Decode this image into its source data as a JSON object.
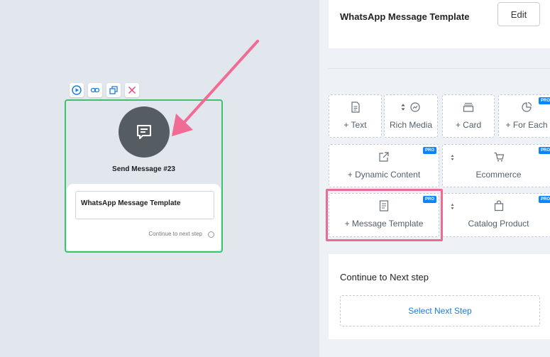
{
  "canvas": {
    "node": {
      "title": "Send Message #23",
      "template_label": "WhatsApp Message Template",
      "continue_label": "Continue to next step"
    }
  },
  "panel": {
    "title": "WhatsApp Message Template",
    "edit_label": "Edit",
    "tiles": [
      {
        "label": "+ Text",
        "icon": "text-icon",
        "pro": ""
      },
      {
        "label": "Rich Media",
        "icon": "rich-media-icon",
        "pro": ""
      },
      {
        "label": "+ Card",
        "icon": "card-icon",
        "pro": ""
      },
      {
        "label": "+ For Each",
        "icon": "for-each-icon",
        "pro": "PRO"
      },
      {
        "label": "+ Dynamic Content",
        "icon": "dynamic-content-icon",
        "pro": "PRO"
      },
      {
        "label": "Ecommerce",
        "icon": "cart-icon",
        "pro": "PRO"
      },
      {
        "label": "+ Message Template",
        "icon": "message-template-icon",
        "pro": "PRO"
      },
      {
        "label": "Catalog Product",
        "icon": "bag-icon",
        "pro": "PRO"
      }
    ],
    "continue_title": "Continue to Next step",
    "select_next_label": "Select Next Step"
  },
  "colors": {
    "node_border": "#3cc46a",
    "node_icon_bg": "#555d63",
    "pro_badge": "#0a84ff",
    "highlight": "#ef6a92",
    "link": "#1a7ee5"
  }
}
